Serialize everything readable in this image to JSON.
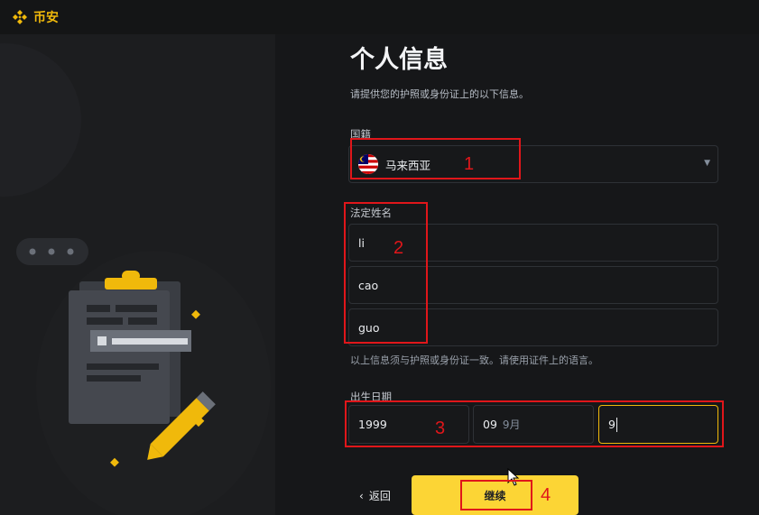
{
  "app": {
    "logo_text": "币安",
    "brand_color": "#f0b90b"
  },
  "form": {
    "title": "个人信息",
    "subtitle": "请提供您的护照或身份证上的以下信息。",
    "nationality": {
      "label": "国籍",
      "value": "马来西亚",
      "flag_icon": "malaysia-flag-icon"
    },
    "legal_name": {
      "label": "法定姓名",
      "first": "li",
      "middle": "cao",
      "last": "guo",
      "hint": "以上信息须与护照或身份证一致。请使用证件上的语言。"
    },
    "dob": {
      "label": "出生日期",
      "year": "1999",
      "month": "09",
      "month_unit": "9月",
      "day": "9"
    },
    "back_label": "返回",
    "continue_label": "继续"
  },
  "annotations": [
    "1",
    "2",
    "3",
    "4"
  ],
  "colors": {
    "accent": "#fcd535",
    "annotation": "#e0161a"
  }
}
